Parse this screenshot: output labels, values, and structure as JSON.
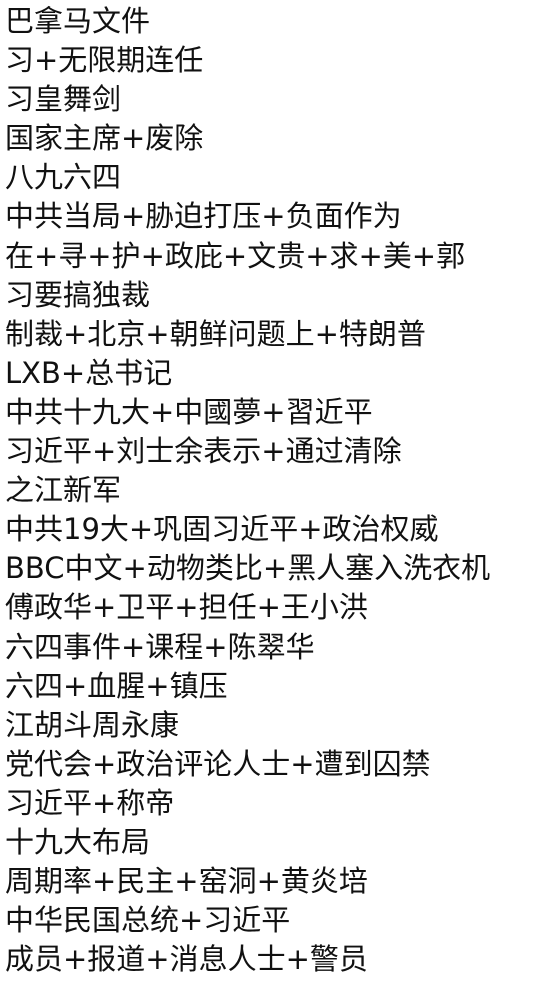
{
  "lines": [
    "巴拿马文件",
    "习+无限期连任",
    "习皇舞剑",
    "国家主席+废除",
    "八九六四",
    "中共当局+胁迫打压+负面作为",
    "在+寻+护+政庇+文贵+求+美+郭",
    "习要搞独裁",
    "制裁+北京+朝鲜问题上+特朗普",
    "LXB+总书记",
    "中共十九大+中國夢+習近平",
    "习近平+刘士余表示+通过清除",
    "之江新军",
    "中共19大+巩固习近平+政治权威",
    "BBC中文+动物类比+黑人塞入洗衣机",
    "傅政华+卫平+担任+王小洪",
    "六四事件+课程+陈翠华",
    "六四+血腥+镇压",
    "江胡斗周永康",
    "党代会+政治评论人士+遭到囚禁",
    "习近平+称帝",
    "十九大布局",
    "周期率+民主+窑洞+黄炎培",
    "中华民国总统+习近平",
    "成员+报道+消息人士+警员"
  ]
}
